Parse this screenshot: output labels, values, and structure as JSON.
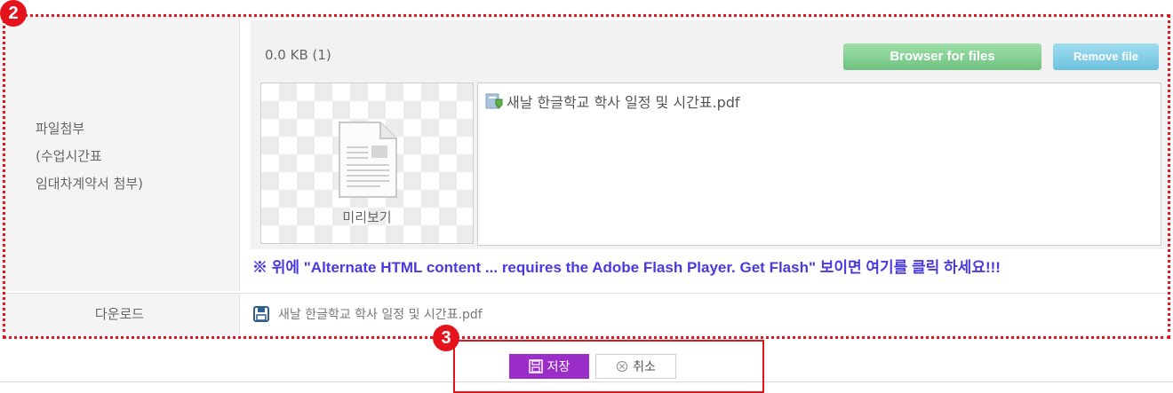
{
  "annotations": {
    "badge_2": "2",
    "badge_3": "3"
  },
  "attachment": {
    "label_lines": [
      "파일첨부",
      "(수업시간표",
      "임대차계약서 첨부)"
    ],
    "file_size": "0.0 KB (1)",
    "browse_label": "Browser for files",
    "remove_label": "Remove file",
    "preview_label": "미리보기",
    "file_name": "새날 한글학교 학사 일정 및 시간표.pdf",
    "flash_note": "※ 위에 \"Alternate HTML content ... requires the Adobe Flash Player. Get Flash\" 보이면 여기를 클릭 하세요!!!"
  },
  "download": {
    "label": "다운로드",
    "file_name": "새날 한글학교 학사 일정 및 시간표.pdf"
  },
  "actions": {
    "save_label": "저장",
    "cancel_label": "취소"
  },
  "colors": {
    "annotation_red": "#e5131b",
    "save_purple": "#9b2dc8",
    "note_blue": "#4a3adf"
  }
}
